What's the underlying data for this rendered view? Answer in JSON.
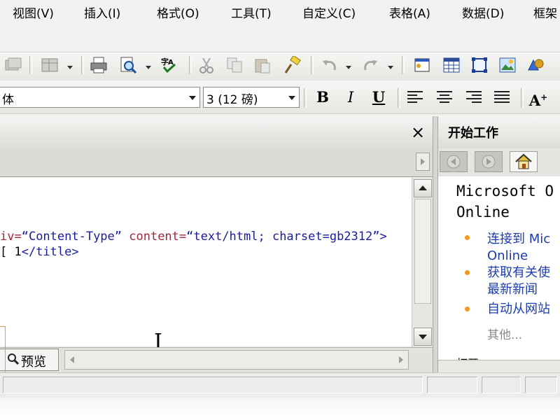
{
  "menubar": {
    "items": [
      "视图(V)",
      "插入(I)",
      "格式(O)",
      "工具(T)",
      "自定义(C)",
      "表格(A)",
      "数据(D)",
      "框架"
    ]
  },
  "format_toolbar": {
    "font_name": "体",
    "font_size": "3  (12 磅)",
    "bold_label": "B",
    "italic_label": "I",
    "underline_label": "U",
    "grow_font_label": "A"
  },
  "editor": {
    "close_label": "×",
    "code_lines": [
      {
        "attr1": "iv=",
        "str1": "“Content-Type”",
        "attr2": " content=",
        "str2": "“text/html; charset=gb2312”",
        "tail": ">"
      },
      {
        "prefix": "[ 1",
        "tag": "</title>"
      }
    ],
    "preview_tab_label": "预览"
  },
  "task_pane": {
    "title": "开始工作",
    "heading": "Microsoft O\nOnline",
    "links": [
      {
        "text": "连接到 Mic",
        "text2": "Online"
      },
      {
        "text": "获取有关使",
        "text2": "最新新闻"
      },
      {
        "text": "自动从网站"
      }
    ],
    "more_label": "其他...",
    "cut_label": "打开"
  },
  "colors": {
    "link": "#1c3cae",
    "bullet": "#f29b1b",
    "code_attr": "#a2253b",
    "code_string": "#1a1aa0"
  }
}
